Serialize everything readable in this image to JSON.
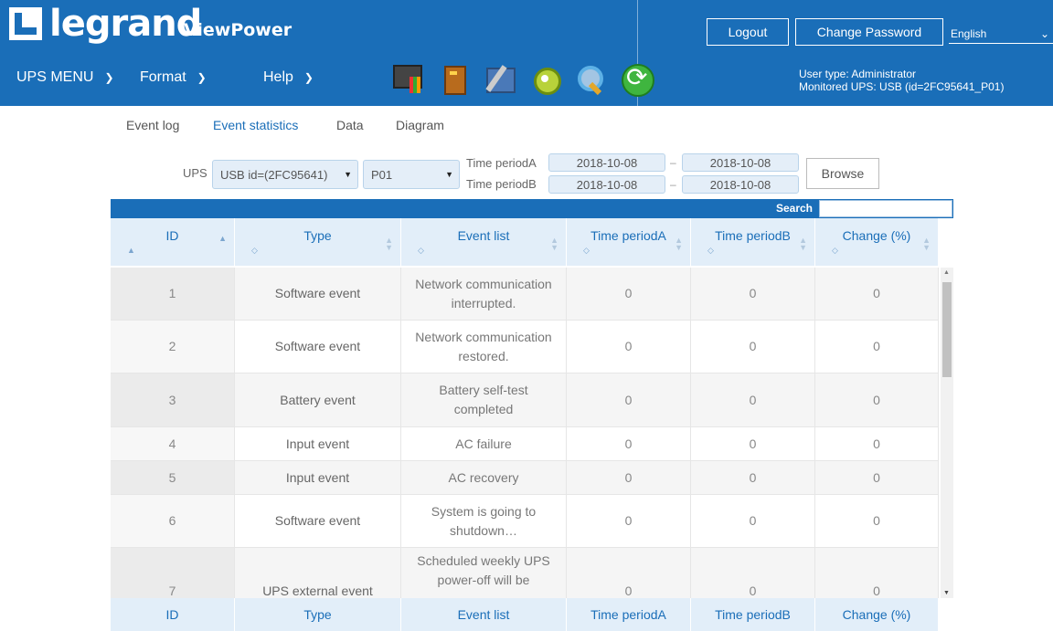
{
  "header": {
    "logo_text": "legrand",
    "product": "ViewPower",
    "logout_label": "Logout",
    "change_password_label": "Change Password",
    "language": "English",
    "menus": [
      "UPS MENU",
      "Format",
      "Help"
    ],
    "icons": [
      "monitor-icon",
      "ups-icon",
      "tools-icon",
      "gear-icon",
      "search-icon",
      "refresh-icon"
    ],
    "user_type": "User type: Administrator",
    "monitored_ups": "Monitored UPS: USB (id=2FC95641_P01)"
  },
  "tabs": [
    "Event log",
    "Event statistics",
    "Data",
    "Diagram"
  ],
  "active_tab": "Event statistics",
  "filter": {
    "ups_label": "UPS",
    "ups_value": "USB id=(2FC95641)",
    "port_value": "P01",
    "period_a_label": "Time periodA",
    "period_b_label": "Time periodB",
    "period_a_from": "2018-10-08",
    "period_a_to": "2018-10-08",
    "period_b_from": "2018-10-08",
    "period_b_to": "2018-10-08",
    "dash": "–",
    "browse_label": "Browse"
  },
  "table": {
    "search_label": "Search",
    "columns": [
      "ID",
      "Type",
      "Event list",
      "Time periodA",
      "Time periodB",
      "Change (%)"
    ],
    "rows": [
      {
        "id": "1",
        "type": "Software event",
        "event": "Network communication interrupted.",
        "a": "0",
        "b": "0",
        "change": "0"
      },
      {
        "id": "2",
        "type": "Software event",
        "event": "Network communication restored.",
        "a": "0",
        "b": "0",
        "change": "0"
      },
      {
        "id": "3",
        "type": "Battery event",
        "event": "Battery self-test completed",
        "a": "0",
        "b": "0",
        "change": "0"
      },
      {
        "id": "4",
        "type": "Input event",
        "event": "AC failure",
        "a": "0",
        "b": "0",
        "change": "0"
      },
      {
        "id": "5",
        "type": "Input event",
        "event": "AC recovery",
        "a": "0",
        "b": "0",
        "change": "0"
      },
      {
        "id": "6",
        "type": "Software event",
        "event": "System is going to shutdown…",
        "a": "0",
        "b": "0",
        "change": "0"
      },
      {
        "id": "7",
        "type": "UPS external event",
        "event": "Scheduled weekly UPS power-off will be",
        "a": "0",
        "b": "0",
        "change": "0"
      }
    ]
  },
  "colors": {
    "brand_blue": "#1a6eb8",
    "header_bg": "#e2eef9"
  }
}
